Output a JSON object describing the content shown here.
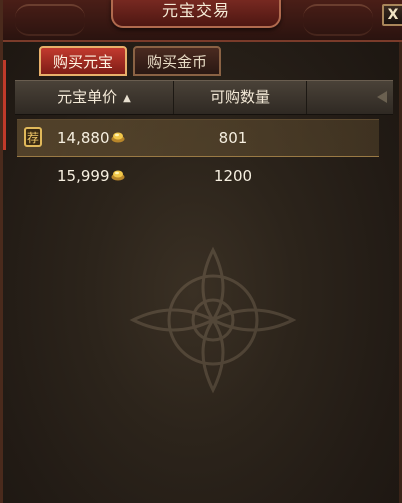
{
  "window": {
    "title": "元宝交易",
    "close_label": "X"
  },
  "tabs": [
    {
      "label": "购买元宝",
      "active": true
    },
    {
      "label": "购买金币",
      "active": false
    }
  ],
  "table": {
    "columns": {
      "price": "元宝单价",
      "qty": "可购数量",
      "sort_icon": "▲"
    },
    "rows": [
      {
        "badge": "荐",
        "price": "14,880",
        "qty": "801",
        "highlighted": true
      },
      {
        "price": "15,999",
        "qty": "1200",
        "highlighted": false
      }
    ]
  },
  "colors": {
    "accent_red": "#c23a2e",
    "gold": "#e0b85a"
  }
}
